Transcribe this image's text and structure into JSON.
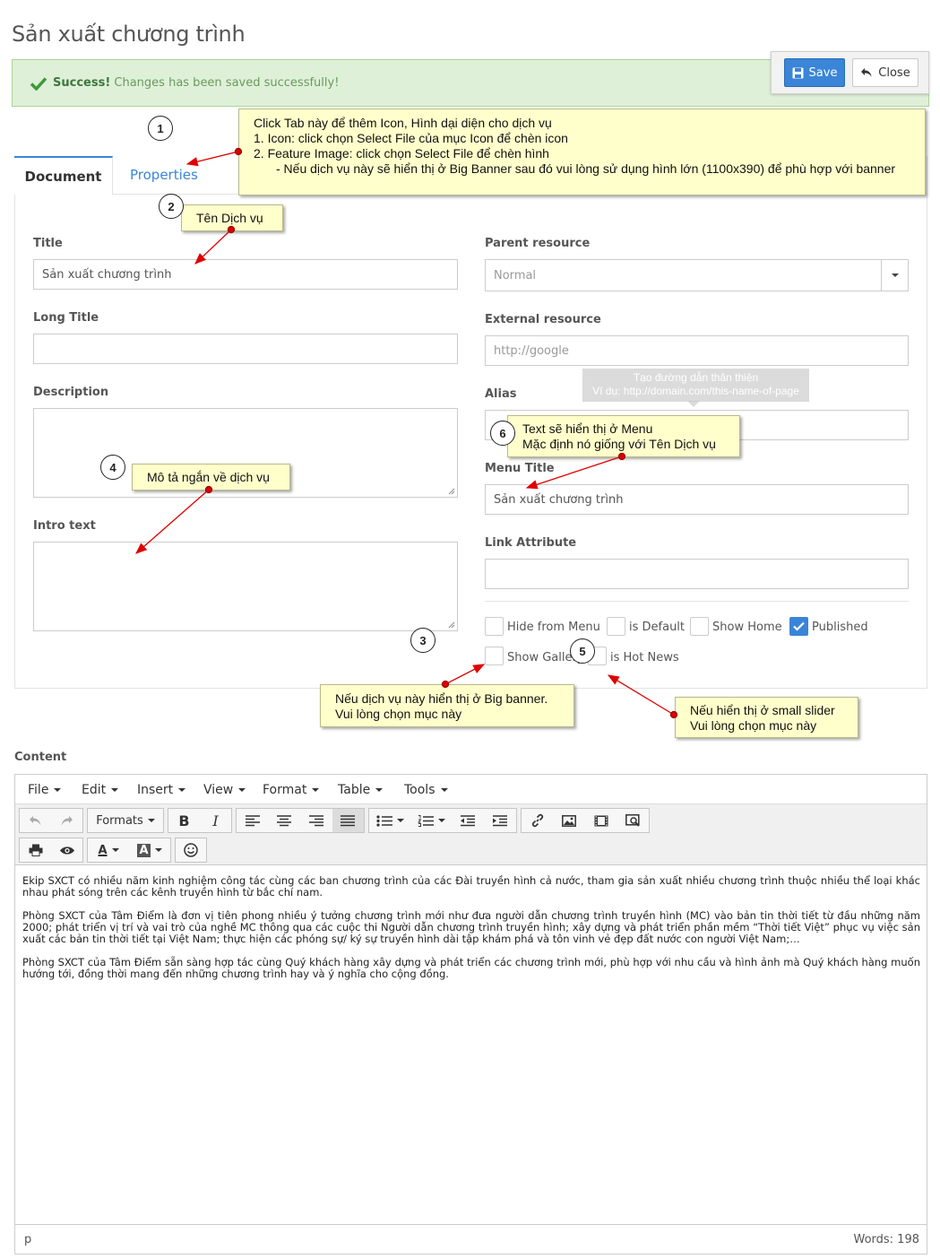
{
  "page_title": "Sản xuất chương trình",
  "alert": {
    "strong": "Success!",
    "message": " Changes has been saved successfully!"
  },
  "actions": {
    "save_label": "Save",
    "close_label": "Close"
  },
  "tabs": [
    {
      "label": "Document"
    },
    {
      "label": "Properties"
    }
  ],
  "left": {
    "title_label": "Title",
    "title_value": "Sản xuất chương trình",
    "long_title_label": "Long Title",
    "long_title_value": "",
    "description_label": "Description",
    "intro_label": "Intro text"
  },
  "right": {
    "parent_label": "Parent resource",
    "parent_value": "Normal",
    "external_label": "External resource",
    "external_placeholder": "http://google",
    "alias_label": "Alias",
    "alias_tooltip_line1": "Tạo đường dẫn thân thiện",
    "alias_tooltip_line2": "Ví dụ: http://domain.com/this-name-of-page",
    "menu_title_label": "Menu Title",
    "menu_title_value": "Sản xuất chương trình",
    "link_attr_label": "Link Attribute"
  },
  "checkboxes": [
    {
      "label": "Hide from Menu",
      "checked": false
    },
    {
      "label": "is Default",
      "checked": false
    },
    {
      "label": "Show Home",
      "checked": false
    },
    {
      "label": "Published",
      "checked": true
    },
    {
      "label": "Show Gallery",
      "checked": false
    },
    {
      "label": "is Hot News",
      "checked": false
    }
  ],
  "annotations": {
    "n1": "1",
    "n2": "2",
    "n3": "3",
    "n4": "4",
    "n5": "5",
    "n6": "6",
    "note1_l1": "Click Tab này để thêm Icon, Hình dại diện cho dịch vụ",
    "note1_l2": "1. Icon: click chọn Select File của mục Icon để chèn icon",
    "note1_l3": "2. Feature Image: click chọn Select File để chèn hình",
    "note1_l4": "- Nếu dịch vụ này sẽ hiển thị ở Big Banner sau đó vui lòng sử dụng hình lớn (1100x390) để phù hợp với banner",
    "note2": "Tên Dịch vụ",
    "note3_l1": "Nếu dịch vụ này hiển thị ở Big banner.",
    "note3_l2": "Vui lòng chọn mục này",
    "note4": "Mô tả ngắn về dịch vụ",
    "note5_l1": "Nếu hiển thị ở small slider",
    "note5_l2": "Vui lòng chọn mục này",
    "note6_l1": "Text sẽ hiển thị ở Menu",
    "note6_l2": "Mặc định nó giống với Tên Dịch vụ"
  },
  "content": {
    "label": "Content",
    "menus": [
      "File",
      "Edit",
      "Insert",
      "View",
      "Format",
      "Table",
      "Tools"
    ],
    "formats_label": "Formats",
    "paragraphs": [
      "Ekip SXCT có nhiều năm kinh nghiệm công tác cùng các ban chương trình của các Đài truyền hình cả nước, tham gia sản xuất nhiều chương trình thuộc nhiều thể loại khác nhau phát sóng trên các kênh truyền hình từ bắc chí nam.",
      "Phòng SXCT của Tâm Điểm là đơn vị tiên phong nhiều ý tưởng chương trình mới như đưa người dẫn chương trình truyền hình (MC) vào bản tin thời tiết từ đầu những năm 2000; phát triển vị trí và vai trò của nghề MC thông qua các cuộc thi Người dẫn chương trình truyền hình; xây dựng và phát triển phần mềm “Thời tiết Việt” phục vụ việc sản xuất các bản tin thời tiết tại Việt Nam; thực hiện các phóng sự/ ký sự truyền hình dài tập khám phá và tôn vinh vẻ đẹp đất nước con người Việt Nam;…",
      "Phòng SXCT của Tâm Điểm sẵn sàng hợp tác cùng Quý khách hàng xây dựng và phát triển các chương trình mới, phù hợp với nhu cầu và hình ảnh mà Quý khách hàng muốn hướng tới, đồng thời mang đến những chương trình hay và ý nghĩa cho cộng đồng."
    ],
    "status_path": "p",
    "word_count": "Words: 198"
  },
  "colors": {
    "accent": "#3a85d8",
    "alert_bg": "#dff0d8",
    "note_bg": "#ffffcc",
    "arrow": "#e00000"
  }
}
